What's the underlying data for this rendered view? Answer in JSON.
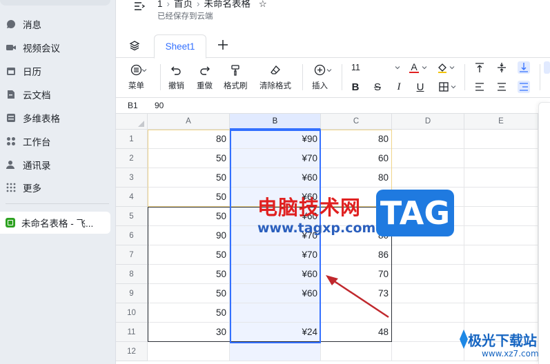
{
  "sidebar": {
    "items": [
      {
        "label": "消息",
        "icon": "chat-icon"
      },
      {
        "label": "视频会议",
        "icon": "video-icon"
      },
      {
        "label": "日历",
        "icon": "calendar-icon"
      },
      {
        "label": "云文档",
        "icon": "doc-icon"
      },
      {
        "label": "多维表格",
        "icon": "table-icon"
      },
      {
        "label": "工作台",
        "icon": "apps-icon"
      },
      {
        "label": "通讯录",
        "icon": "contacts-icon"
      },
      {
        "label": "更多",
        "icon": "more-icon"
      }
    ],
    "open_doc": "未命名表格 - 飞..."
  },
  "header": {
    "crumb_root": "1",
    "crumb_home": "首页",
    "title": "未命名表格",
    "status": "已经保存到云端"
  },
  "tabs": {
    "sheet": "Sheet1"
  },
  "toolbar": {
    "menu": "菜单",
    "undo": "撤销",
    "redo": "重做",
    "format_painter": "格式刷",
    "clear_format": "清除格式",
    "insert": "插入",
    "font_size": "11",
    "font_color_glyph": "A",
    "bold_glyph": "B",
    "strike_glyph": "S",
    "italic_glyph": "I",
    "underline_glyph": "U"
  },
  "formula_bar": {
    "cell_ref": "B1",
    "value": "90"
  },
  "sheet": {
    "columns": [
      "A",
      "B",
      "C",
      "D",
      "E"
    ],
    "rows": [
      {
        "num": "1",
        "a": "80",
        "b": "¥90",
        "c": "80"
      },
      {
        "num": "2",
        "a": "50",
        "b": "¥70",
        "c": "60"
      },
      {
        "num": "3",
        "a": "50",
        "b": "¥60",
        "c": "80"
      },
      {
        "num": "4",
        "a": "50",
        "b": "¥60",
        "c": "75"
      },
      {
        "num": "5",
        "a": "50",
        "b": "¥60",
        "c": "70"
      },
      {
        "num": "6",
        "a": "90",
        "b": "¥70",
        "c": "80"
      },
      {
        "num": "7",
        "a": "50",
        "b": "¥70",
        "c": "86"
      },
      {
        "num": "8",
        "a": "50",
        "b": "¥60",
        "c": "70"
      },
      {
        "num": "9",
        "a": "50",
        "b": "¥60",
        "c": "73"
      },
      {
        "num": "10",
        "a": "50",
        "b": "",
        "c": ""
      },
      {
        "num": "11",
        "a": "30",
        "b": "¥24",
        "c": "48"
      },
      {
        "num": "12",
        "a": "",
        "b": "",
        "c": ""
      }
    ],
    "partial_text": "极"
  },
  "watermark": {
    "cn": "电脑技术网",
    "url": "www.tagxp.com",
    "tag": "TAG",
    "site": "极光下载站",
    "site_url": "www.xz7.com"
  },
  "colors": {
    "accent": "#3370ff",
    "selection_fill": "#eef3ff",
    "border_highlight": "#f0d58a",
    "watermark_red": "#e02020",
    "watermark_blue": "#1f7ae0"
  }
}
